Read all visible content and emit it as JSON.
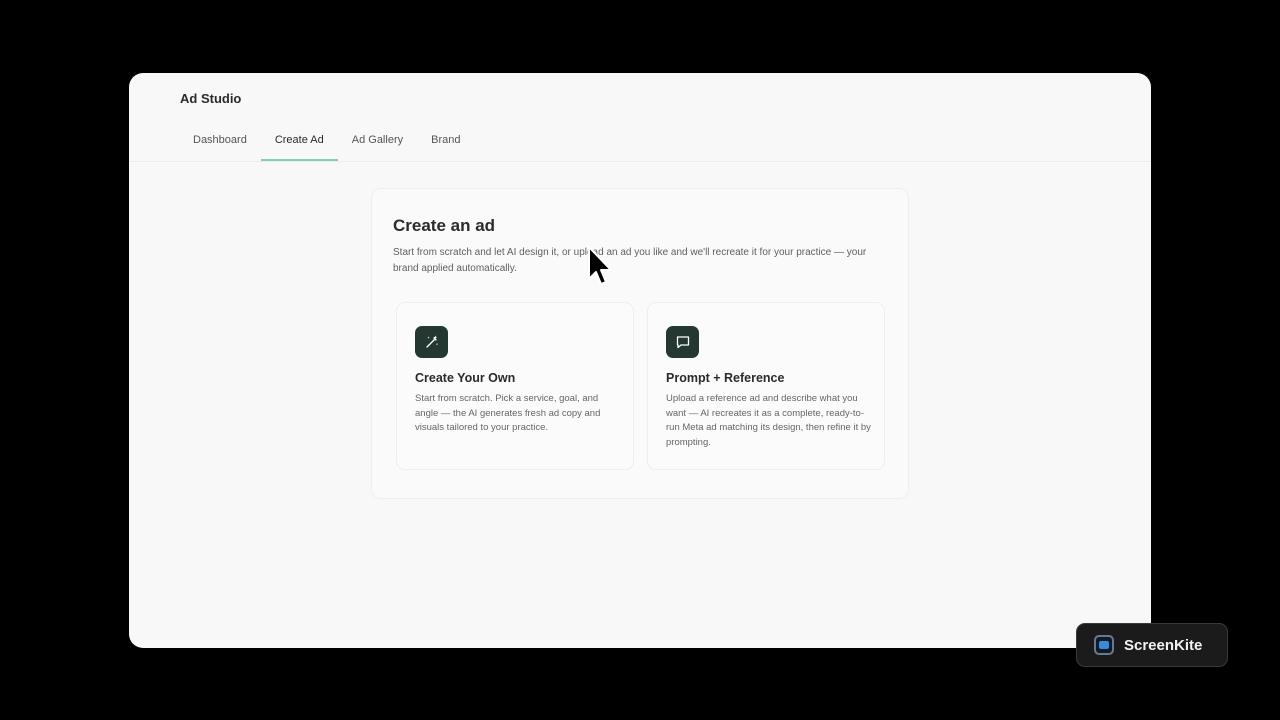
{
  "app": {
    "title": "Ad Studio"
  },
  "tabs": [
    {
      "label": "Dashboard"
    },
    {
      "label": "Create Ad",
      "active": true
    },
    {
      "label": "Ad Gallery"
    },
    {
      "label": "Brand"
    }
  ],
  "create": {
    "title": "Create an ad",
    "description": "Start from scratch and let AI design it, or upload an ad you like and we'll recreate it for your practice — your brand applied automatically.",
    "options": [
      {
        "icon": "magic-wand-icon",
        "title": "Create Your Own",
        "description": "Start from scratch. Pick a service, goal, and angle — the AI generates fresh ad copy and visuals tailored to your practice."
      },
      {
        "icon": "chat-bubble-icon",
        "title": "Prompt + Reference",
        "description": "Upload a reference ad and describe what you want — AI recreates it as a complete, ready-to-run Meta ad matching its design, then refine it by prompting."
      }
    ]
  },
  "badge": {
    "label": "ScreenKite"
  },
  "colors": {
    "accent": "#7fd1b2",
    "icon_bg": "#243730",
    "background": "#000000",
    "window": "#f8f8f8"
  }
}
